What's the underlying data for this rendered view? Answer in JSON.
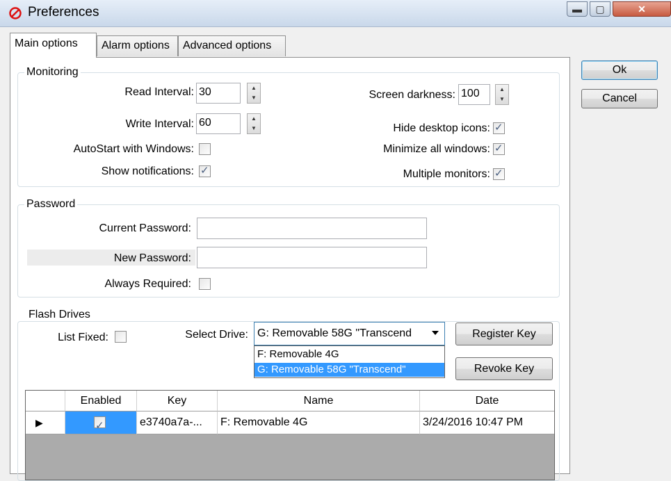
{
  "window": {
    "title": "Preferences"
  },
  "tabs": [
    "Main options",
    "Alarm options",
    "Advanced options"
  ],
  "buttons": {
    "ok": "Ok",
    "cancel": "Cancel",
    "register_key": "Register Key",
    "revoke_key": "Revoke Key"
  },
  "monitoring": {
    "legend": "Monitoring",
    "read_interval_label": "Read Interval:",
    "read_interval_value": "30",
    "write_interval_label": "Write Interval:",
    "write_interval_value": "60",
    "autostart_label": "AutoStart with Windows:",
    "autostart_checked": false,
    "show_notifications_label": "Show notifications:",
    "show_notifications_checked": true,
    "screen_darkness_label": "Screen darkness:",
    "screen_darkness_value": "100",
    "hide_desktop_icons_label": "Hide desktop icons:",
    "hide_desktop_icons_checked": true,
    "minimize_all_label": "Minimize all windows:",
    "minimize_all_checked": true,
    "multiple_monitors_label": "Multiple monitors:",
    "multiple_monitors_checked": true
  },
  "password": {
    "legend": "Password",
    "current_label": "Current Password:",
    "current_value": "",
    "new_label": "New Password:",
    "new_value": "",
    "always_required_label": "Always Required:",
    "always_required_checked": false
  },
  "flash_drives": {
    "legend": "Flash Drives",
    "list_fixed_label": "List Fixed:",
    "list_fixed_checked": false,
    "select_drive_label": "Select Drive:",
    "selected_drive": "G: Removable 58G \"Transcend",
    "options": [
      "F: Removable 4G",
      "G: Removable 58G \"Transcend\""
    ],
    "selected_option_index": 1
  },
  "grid": {
    "columns": [
      "Enabled",
      "Key",
      "Name",
      "Date"
    ],
    "rows": [
      {
        "enabled": true,
        "key": "e3740a7a-...",
        "name": "F: Removable 4G",
        "date": "3/24/2016 10:47 PM"
      }
    ]
  },
  "colors": {
    "selection": "#3399ff",
    "accent_border": "#3c7fb1"
  }
}
